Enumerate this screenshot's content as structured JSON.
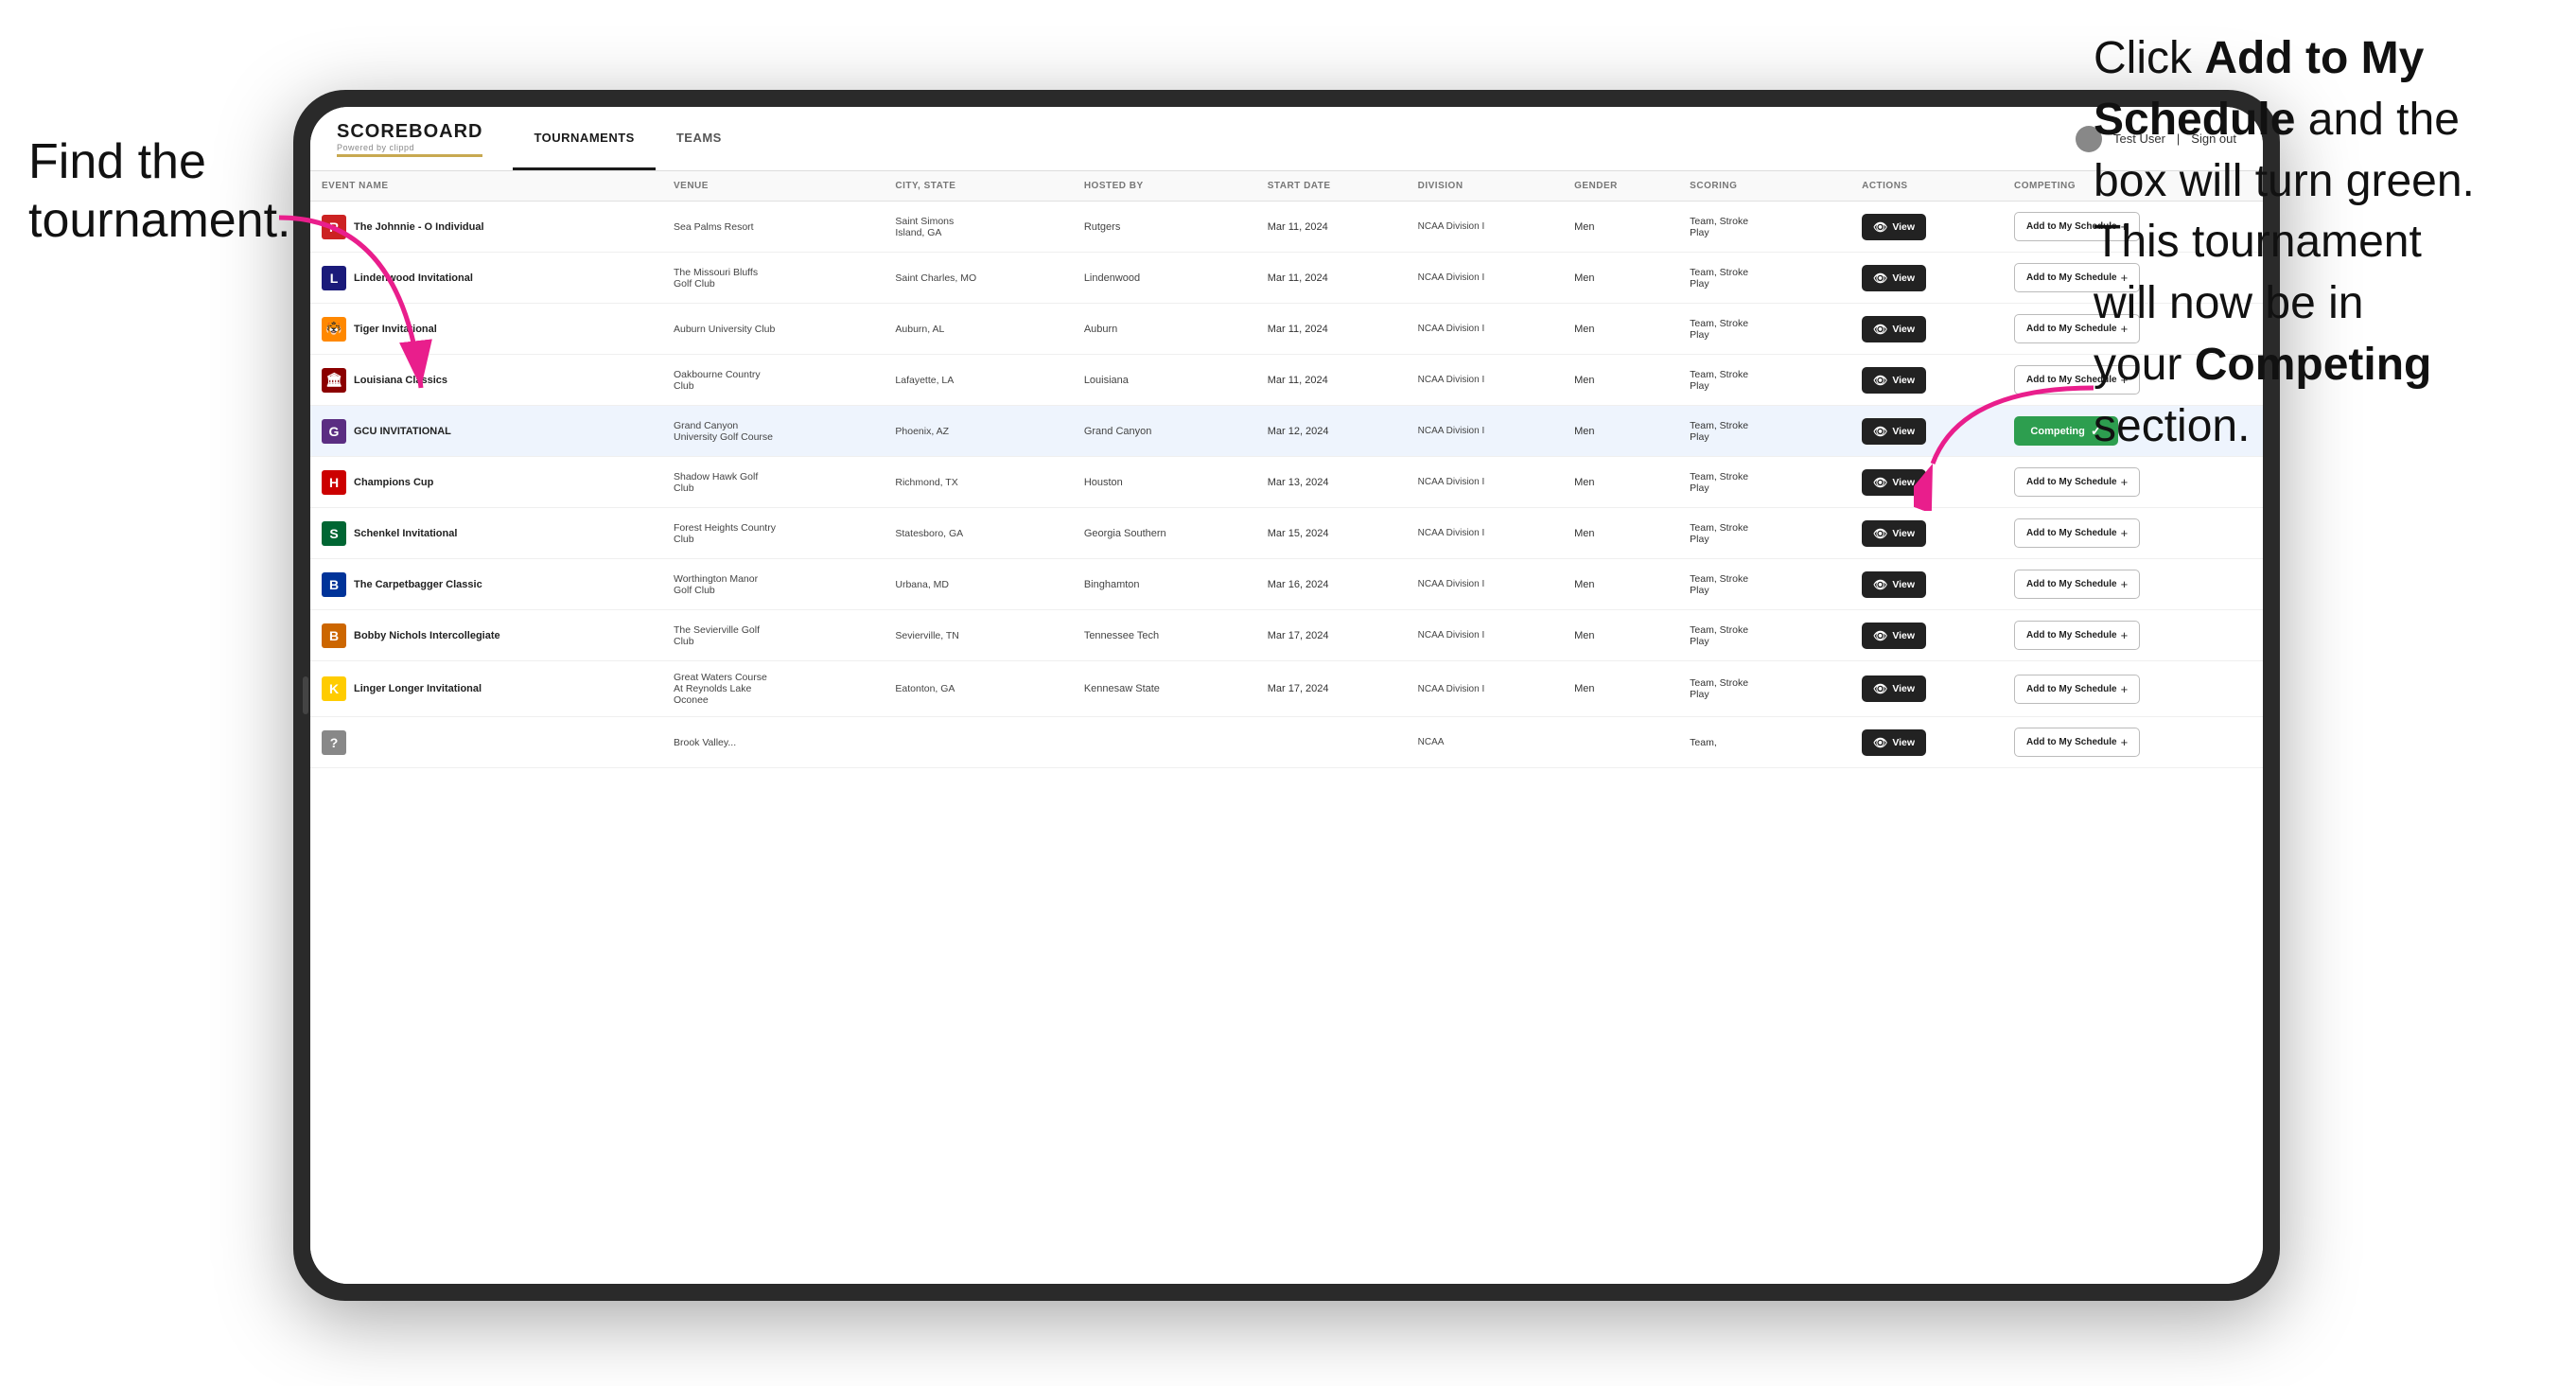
{
  "annotations": {
    "left": "Find the\ntournament.",
    "right_parts": [
      {
        "text": "Click ",
        "bold": false
      },
      {
        "text": "Add to My\nSchedule",
        "bold": true
      },
      {
        "text": " and the\nbox will turn green.\nThis tournament\nwill now be in\nyour ",
        "bold": false
      },
      {
        "text": "Competing",
        "bold": true
      },
      {
        "text": "\nsection.",
        "bold": false
      }
    ]
  },
  "header": {
    "logo": "SCOREBOARD",
    "logo_sub": "Powered by clippd",
    "nav": [
      "TOURNAMENTS",
      "TEAMS"
    ],
    "active_nav": "TOURNAMENTS",
    "user": "Test User",
    "sign_out": "Sign out"
  },
  "table": {
    "columns": [
      "EVENT NAME",
      "VENUE",
      "CITY, STATE",
      "HOSTED BY",
      "START DATE",
      "DIVISION",
      "GENDER",
      "SCORING",
      "ACTIONS",
      "COMPETING"
    ],
    "rows": [
      {
        "logo_char": "R",
        "logo_color": "#cc2222",
        "name": "The Johnnie - O Individual",
        "venue": "Sea Palms Resort",
        "city": "Saint Simons Island, GA",
        "hosted": "Rutgers",
        "date": "Mar 11, 2024",
        "division": "NCAA Division I",
        "gender": "Men",
        "scoring": "Team, Stroke Play",
        "competing": "Add to My Schedule",
        "highlighted": false
      },
      {
        "logo_char": "L",
        "logo_color": "#1a1a7a",
        "name": "Lindenwood Invitational",
        "venue": "The Missouri Bluffs Golf Club",
        "city": "Saint Charles, MO",
        "hosted": "Lindenwood",
        "date": "Mar 11, 2024",
        "division": "NCAA Division I",
        "gender": "Men",
        "scoring": "Team, Stroke Play",
        "competing": "Add to My Schedule",
        "highlighted": false
      },
      {
        "logo_char": "🐯",
        "logo_color": "#ff8800",
        "name": "Tiger Invitational",
        "venue": "Auburn University Club",
        "city": "Auburn, AL",
        "hosted": "Auburn",
        "date": "Mar 11, 2024",
        "division": "NCAA Division I",
        "gender": "Men",
        "scoring": "Team, Stroke Play",
        "competing": "Add to My Schedule",
        "highlighted": false
      },
      {
        "logo_char": "🏛",
        "logo_color": "#8b0000",
        "name": "Louisiana Classics",
        "venue": "Oakbourne Country Club",
        "city": "Lafayette, LA",
        "hosted": "Louisiana",
        "date": "Mar 11, 2024",
        "division": "NCAA Division I",
        "gender": "Men",
        "scoring": "Team, Stroke Play",
        "competing": "Add to My Schedule",
        "highlighted": false
      },
      {
        "logo_char": "G",
        "logo_color": "#5b2d82",
        "name": "GCU INVITATIONAL",
        "venue": "Grand Canyon University Golf Course",
        "city": "Phoenix, AZ",
        "hosted": "Grand Canyon",
        "date": "Mar 12, 2024",
        "division": "NCAA Division I",
        "gender": "Men",
        "scoring": "Team, Stroke Play",
        "competing": "Competing",
        "highlighted": true
      },
      {
        "logo_char": "H",
        "logo_color": "#cc0000",
        "name": "Champions Cup",
        "venue": "Shadow Hawk Golf Club",
        "city": "Richmond, TX",
        "hosted": "Houston",
        "date": "Mar 13, 2024",
        "division": "NCAA Division I",
        "gender": "Men",
        "scoring": "Team, Stroke Play",
        "competing": "Add to My Schedule",
        "highlighted": false
      },
      {
        "logo_char": "S",
        "logo_color": "#006633",
        "name": "Schenkel Invitational",
        "venue": "Forest Heights Country Club",
        "city": "Statesboro, GA",
        "hosted": "Georgia Southern",
        "date": "Mar 15, 2024",
        "division": "NCAA Division I",
        "gender": "Men",
        "scoring": "Team, Stroke Play",
        "competing": "Add to My Schedule",
        "highlighted": false
      },
      {
        "logo_char": "B",
        "logo_color": "#003399",
        "name": "The Carpetbagger Classic",
        "venue": "Worthington Manor Golf Club",
        "city": "Urbana, MD",
        "hosted": "Binghamton",
        "date": "Mar 16, 2024",
        "division": "NCAA Division I",
        "gender": "Men",
        "scoring": "Team, Stroke Play",
        "competing": "Add to My Schedule",
        "highlighted": false
      },
      {
        "logo_char": "B",
        "logo_color": "#cc6600",
        "name": "Bobby Nichols Intercollegiate",
        "venue": "The Sevierville Golf Club",
        "city": "Sevierville, TN",
        "hosted": "Tennessee Tech",
        "date": "Mar 17, 2024",
        "division": "NCAA Division I",
        "gender": "Men",
        "scoring": "Team, Stroke Play",
        "competing": "Add to My Schedule",
        "highlighted": false
      },
      {
        "logo_char": "K",
        "logo_color": "#ffcc00",
        "name": "Linger Longer Invitational",
        "venue": "Great Waters Course At Reynolds Lake Oconee",
        "city": "Eatonton, GA",
        "hosted": "Kennesaw State",
        "date": "Mar 17, 2024",
        "division": "NCAA Division I",
        "gender": "Men",
        "scoring": "Team, Stroke Play",
        "competing": "Add to My Schedule",
        "highlighted": false
      },
      {
        "logo_char": "?",
        "logo_color": "#888",
        "name": "",
        "venue": "Brook Valley...",
        "city": "",
        "hosted": "",
        "date": "",
        "division": "NCAA",
        "gender": "",
        "scoring": "Team,",
        "competing": "Add to My Schedule",
        "highlighted": false
      }
    ]
  },
  "buttons": {
    "view": "View",
    "add_to_schedule": "Add to My Schedule",
    "competing": "Competing",
    "plus": "+",
    "check": "✓"
  }
}
